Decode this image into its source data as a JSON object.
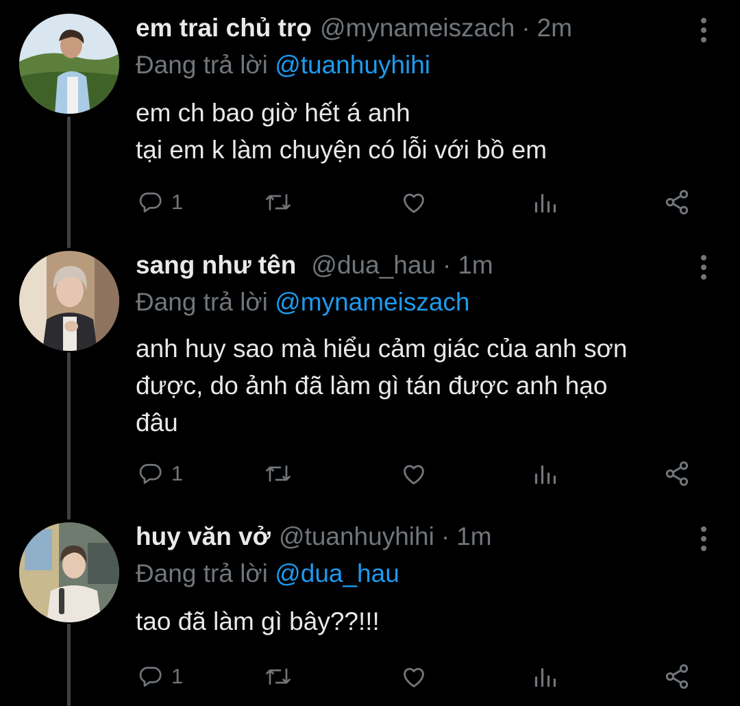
{
  "tweets": [
    {
      "name": "em trai chủ trọ",
      "handle": "@mynameiszach",
      "separator": "·",
      "time": "2m",
      "replying_prefix": "Đang trả lời",
      "replying_to": "@tuanhuyhihi",
      "text_lines": [
        "em ch bao giờ hết á anh",
        "tại em k làm chuyện có lỗi với bồ em"
      ],
      "reply_count": "1"
    },
    {
      "name": "sang như tên",
      "handle": "@dua_hau",
      "separator": "·",
      "time": "1m",
      "replying_prefix": "Đang trả lời",
      "replying_to": "@mynameiszach",
      "text_lines": [
        "anh huy sao mà hiểu cảm giác của anh sơn",
        "được, do ảnh đã làm gì tán được anh hạo",
        "đâu"
      ],
      "reply_count": "1"
    },
    {
      "name": "huy văn vở",
      "handle": "@tuanhuyhihi",
      "separator": "·",
      "time": "1m",
      "replying_prefix": "Đang trả lời",
      "replying_to": "@dua_hau",
      "text_lines": [
        "tao đã làm gì bây??!!!"
      ],
      "reply_count": "1"
    }
  ],
  "icons": {
    "reply": "reply-icon",
    "retweet": "retweet-icon",
    "like": "like-icon",
    "analytics": "analytics-icon",
    "share": "share-icon",
    "more": "more-vertical-icon"
  },
  "colors": {
    "background": "#000000",
    "text": "#e7e9ea",
    "secondary": "#71767b",
    "mention": "#1d9bf0",
    "thread_line": "#3e4144"
  }
}
